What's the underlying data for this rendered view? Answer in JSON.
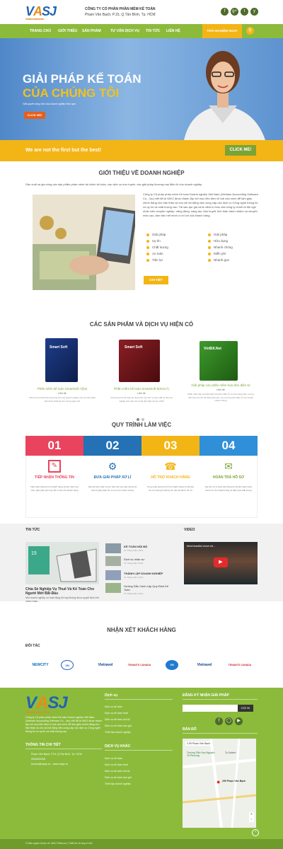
{
  "header": {
    "company_name": "CÔNG TY CỔ PHẦN PHẦN MỀM KẾ TOÁN",
    "address": "Phạm Văn Bạch, P.15, Q.Tân Bình, Tp. HCM",
    "social": [
      "f",
      "g+",
      "t",
      "y"
    ]
  },
  "nav": {
    "items": [
      "TRANG CHỦ",
      "GIỚI THIỆU",
      "SẢN PHẨM",
      "TƯ VẤN DỊCH VỤ",
      "TIN TỨC",
      "LIÊN HỆ"
    ],
    "trial": "TRẢI NGHIỆM NGAY"
  },
  "hero": {
    "title_line1": "GIẢI PHÁP KẾ TOÁN",
    "title_line2": "CỦA CHÚNG TÔI",
    "subtitle": "Giải quyết công việc của doanh nghiệp hiệu quả",
    "button": "CLICK ME!"
  },
  "band": {
    "text": "We are not the first but the best!",
    "button": "CLICK ME!"
  },
  "intro": {
    "title": "GIỚI THIỆU VỀ DOANH NGHIỆP",
    "lead": "Sản xuất và gia công các sản phẩm phần mềm tài chính kế toán, các dịch vụ trực tuyến, các giải pháp thương mại điện tử cho doanh nghiệp",
    "body": "Công ty Cổ phần phần mềm Kế toán Doanh nghiệp Việt Nam (Vietnam Accounting Software Co., Jsc) viết tắt là VASJ được thành lập với mục tiêu đem trí tuệ của mình để làm giàu chính đáng cho bản thân và cho xã hội bằng việc cung cấp các dịch vụ Công nghệ thông tin có uy tín và chất lượng cao. Tài sản quí giá và là niềm tự hào của công ty chính là đội ngũ nhân viên chuyên nghiệp, năng động, sáng tạo, tâm huyết, tinh thần trách nhiệm và chuyên môn cao, làm việc hết mình vì lợi ích của khách hàng.",
    "features_left": [
      "Giải pháp",
      "Uy tín",
      "Chất lượng",
      "An toàn",
      "Tiện lợi"
    ],
    "features_right": [
      "Giải pháp",
      "Hữu dụng",
      "Nhanh chóng",
      "Miễn phí",
      "Nhanh gọn"
    ],
    "button": "CHI TIẾT"
  },
  "products": {
    "title": "CÁC SẢN PHẨM VÀ DỊCH VỤ HIỆN CÓ",
    "items": [
      {
        "box": "Smart Soft",
        "name": "Phần mềm kế toán SmartSoft 7(bs)",
        "link": "Liên hệ",
        "desc": "Chương trình kế toán áp dụng cho các doanh nghiệp vừa và nhỏ phiên bản được thiết kế trên công nghệ mới"
      },
      {
        "box": "Smart Soft",
        "name": "Phần mềm kế toán SmartSoft 9(Sm17)",
        "link": "Liên hệ",
        "desc": "Chương trình kế toán áp dụng cho các đơn vị sản xuất và thương nghiệp trên nền C# và dữ liệu SQL Server 2016"
      },
      {
        "box": "VinBill.Net",
        "name": "Giải pháp các phần mềm hóa đơn điện tử",
        "link": "Liên hệ",
        "desc": "Phần mềm lập và phát hành hóa đơn điện tử có tính năng hiệu, tương thích tốt với các hệ thống kế toán, tra cứu hóa đơn điện tử trực tuyến nhanh chóng"
      }
    ]
  },
  "process": {
    "title": "QUY TRÌNH LÀM VIỆC",
    "steps": [
      {
        "num": "01",
        "title": "TIẾP NHẬN THÔNG TIN",
        "desc": "Tiếp nhận thông tin từ khách hàng và tiến hành lựa chọn giải pháp phù hợp để tư vấn cho khách hàng"
      },
      {
        "num": "02",
        "title": "ĐƯA GIẢI PHÁP XỬ LÍ",
        "desc": "Sau khi tiếp nhận và tìm hiểu các yêu cầu chúng tôi đưa ra giải pháp tối ưu và xử lý nhanh chóng"
      },
      {
        "num": "03",
        "title": "HỖ TRỢ KHÁCH HÀNG",
        "desc": "Trong suốt quá trình hỗ trợ khách hàng có thể liên hệ với chúng tôi bất kỳ lúc nào để được hỗ trợ"
      },
      {
        "num": "04",
        "title": "HOÀN TRẢ HỒ SƠ",
        "desc": "Sau khi xử lý hoàn tất chúng tôi sẽ tiến hành hoàn trả hồ sơ cho khách hàng và đánh giá chất lượng"
      }
    ]
  },
  "news": {
    "label": "TIN TỨC",
    "featured_title": "Chia Sẻ Nghiệp Vụ Thuế Và Kế Toán Cho Người Mới Bắt Đầu",
    "featured_desc": "Một doanh nghiệp có hoạt động tốt hay không được quyết định bởi nhiều nhân...",
    "items": [
      {
        "title": "KẾ TOÁN NỘI BỘ",
        "date": "21 Tháng Năm 2016"
      },
      {
        "title": "Dịch vụ nhân sự",
        "date": "21 Tháng Năm 2016"
      },
      {
        "title": "THÀNH LẬP DOANH NGHIỆP",
        "date": "21 Tháng Năm 2016"
      },
      {
        "title": "Hướng Dẫn Cách Lập Quy Định Kế Toán",
        "date": "21 Tháng Năm 2016"
      }
    ]
  },
  "video": {
    "label": "VIDEO",
    "caption": "Most beautiful drone vid..."
  },
  "testimonials": {
    "title": "NHẬN XÉT KHÁCH HÀNG"
  },
  "partners": {
    "label": "ĐỐI TÁC",
    "items": [
      "NEWCITY",
      "VN",
      "Vietravel",
      "TENANTS CANADA",
      "VN",
      "Vietravel",
      "TENANTS CANADA"
    ]
  },
  "footer": {
    "about": "Công ty Cổ phần phần mềm Kế toán Doanh nghiệp Việt Nam (Vietnam Accounting Software Co., Jsc) viết tắt là VASJ được thành lập với mục tiêu đem trí tuệ của mình để làm giàu chính đáng cho bản thân và cho xã hội bằng việc cung cấp các dịch vụ Công nghệ thông tin có uy tín và chất lượng cao.",
    "contact_title": "THÔNG TIN CHI TIẾT",
    "contact_lines": [
      "Phạm Văn Bạch, P.15, Q.Tân Bình, Tp. HCM",
      "0944002209",
      "ketoan@vasjx.vn - www.vasjx.vn"
    ],
    "service_title": "Dịch vụ",
    "service_links": [
      "Dịch vụ kế toán",
      "Dịch vụ kế toán thuế",
      "Dịch vụ kế toán nội bộ",
      "Dịch vụ kế toán trọn gói",
      "Thiết lập doanh nghiệp"
    ],
    "other_title": "DỊCH VỤ KHÁC",
    "other_links": [
      "Dịch vụ kế toán",
      "Dịch vụ kế toán thuế",
      "Dịch vụ kế toán nội bộ",
      "Dịch vụ kế toán trọn gói",
      "Thiết lập doanh nghiệp"
    ],
    "subscribe_title": "ĐĂNG KÝ NHẬN GIẢI PHÁP",
    "subscribe_button": "GỬI ĐI",
    "map_title": "BẢN ĐỒ",
    "map_labels": [
      "2.95 Phạm Văn Bạch",
      "Trường Tiểu Học Nguyễn Tri Phương",
      "295 Phạm Văn Bạch",
      "Ty Saiden"
    ],
    "copyright": "© Bản quyền thuộc về VASJ Telecom | Thiết kế và duy trì bởi"
  }
}
